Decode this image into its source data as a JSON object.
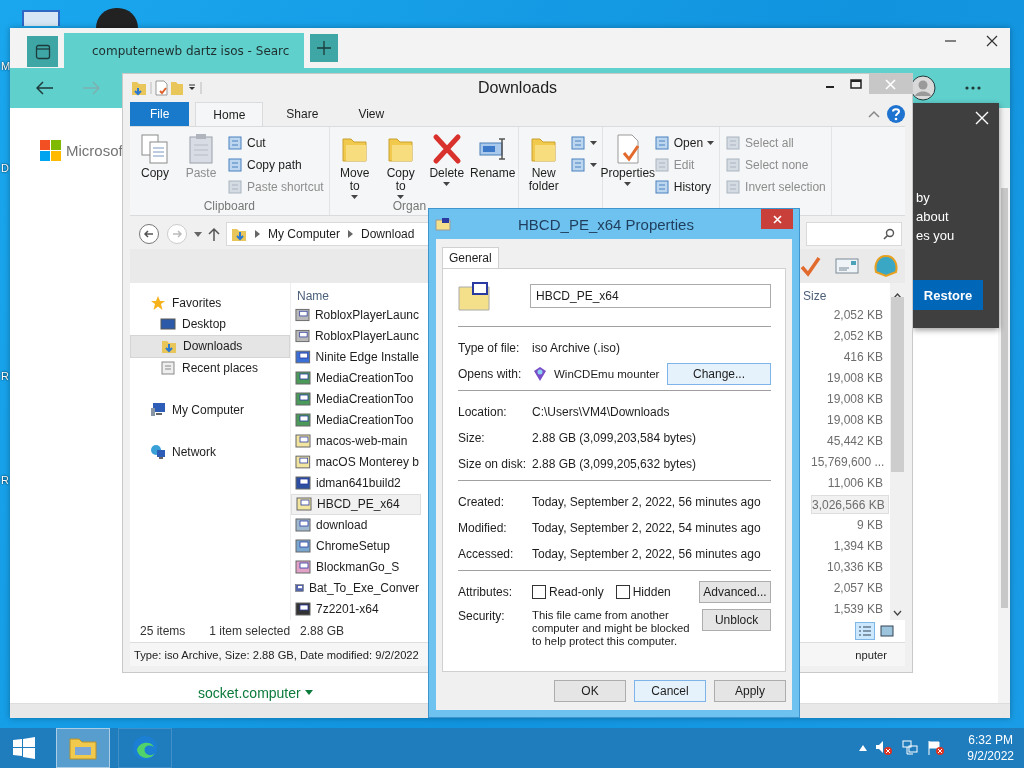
{
  "desktop": {
    "edge_labels": [
      "M",
      "D",
      "R",
      "R"
    ]
  },
  "browser": {
    "tab": {
      "title": "computernewb dartz isos - Searc"
    },
    "logo_text": "Microsof",
    "link": "socket.computer",
    "notice": {
      "lines": [
        "by",
        "about",
        "es you"
      ],
      "button": "Restore"
    }
  },
  "explorer": {
    "title": "Downloads",
    "ribbon_tabs": [
      {
        "label": "File",
        "kind": "menu",
        "selected": false
      },
      {
        "label": "Home",
        "kind": "tab",
        "selected": true
      },
      {
        "label": "Share",
        "kind": "tab",
        "selected": false
      },
      {
        "label": "View",
        "kind": "tab",
        "selected": false
      }
    ],
    "groups": [
      {
        "label": "Clipboard",
        "large": [
          {
            "label": "Copy",
            "dropdown": false,
            "disabled": false
          },
          {
            "label": "Paste",
            "dropdown": false,
            "disabled": true
          }
        ],
        "small": [
          {
            "label": "Cut",
            "dropdown": false,
            "disabled": false
          },
          {
            "label": "Copy path",
            "dropdown": false,
            "disabled": false
          },
          {
            "label": "Paste shortcut",
            "dropdown": false,
            "disabled": true
          }
        ]
      },
      {
        "label": "Organ",
        "large": [
          {
            "label": "Move to",
            "dropdown": true,
            "disabled": false
          },
          {
            "label": "Copy to",
            "dropdown": true,
            "disabled": false
          },
          {
            "label": "Delete",
            "dropdown": true,
            "disabled": false
          },
          {
            "label": "Rename",
            "dropdown": false,
            "disabled": false
          }
        ]
      },
      {
        "large": [
          {
            "label": "New folder",
            "dropdown": false,
            "disabled": false
          }
        ],
        "small": [
          {
            "dropdown": true,
            "disabled": false
          },
          {
            "dropdown": true,
            "disabled": false
          }
        ]
      },
      {
        "large": [
          {
            "label": "Properties",
            "dropdown": true,
            "disabled": false
          }
        ],
        "small": [
          {
            "label": "Open",
            "dropdown": true,
            "disabled": false
          },
          {
            "label": "Edit",
            "dropdown": false,
            "disabled": true
          },
          {
            "label": "History",
            "dropdown": false,
            "disabled": false
          }
        ]
      },
      {
        "small": [
          {
            "label": "Select all",
            "dropdown": false,
            "disabled": true
          },
          {
            "label": "Select none",
            "dropdown": false,
            "disabled": true
          },
          {
            "label": "Invert selection",
            "dropdown": false,
            "disabled": true
          }
        ]
      }
    ],
    "crumbs": [
      "My Computer",
      "Download"
    ],
    "nav": [
      {
        "label": "Favorites",
        "selected": false,
        "children": [
          {
            "label": "Desktop",
            "selected": false
          },
          {
            "label": "Downloads",
            "selected": true
          },
          {
            "label": "Recent places",
            "selected": false
          }
        ]
      },
      {
        "label": "My Computer",
        "selected": false
      },
      {
        "label": "Network",
        "selected": false
      }
    ],
    "columns": {
      "name": "Name",
      "size": "Size"
    },
    "files": [
      {
        "name": "RobloxPlayerLaunc",
        "size": "2,052 KB",
        "selected": false
      },
      {
        "name": "RobloxPlayerLaunc",
        "size": "2,052 KB",
        "selected": false
      },
      {
        "name": "Ninite Edge Installe",
        "size": "416 KB",
        "selected": false
      },
      {
        "name": "MediaCreationToo",
        "size": "19,008 KB",
        "selected": false
      },
      {
        "name": "MediaCreationToo",
        "size": "19,008 KB",
        "selected": false
      },
      {
        "name": "MediaCreationToo",
        "size": "19,008 KB",
        "selected": false
      },
      {
        "name": "macos-web-main",
        "size": "45,442 KB",
        "selected": false
      },
      {
        "name": "macOS Monterey b",
        "size": "15,769,600 ...",
        "selected": false
      },
      {
        "name": "idman641build2",
        "size": "11,006 KB",
        "selected": false
      },
      {
        "name": "HBCD_PE_x64",
        "size": "3,026,566 KB",
        "selected": true
      },
      {
        "name": "download",
        "size": "9 KB",
        "selected": false
      },
      {
        "name": "ChromeSetup",
        "size": "1,394 KB",
        "selected": false
      },
      {
        "name": "BlockmanGo_S",
        "size": "10,336 KB",
        "selected": false
      },
      {
        "name": "Bat_To_Exe_Conver",
        "size": "2,057 KB",
        "selected": false
      },
      {
        "name": "7z2201-x64",
        "size": "1,539 KB",
        "selected": false
      }
    ],
    "status": {
      "count": "25 items",
      "selection": "1 item selected",
      "selection_size": "2.88 GB"
    },
    "views": [
      {
        "selected": true
      },
      {
        "selected": false
      }
    ],
    "details": {
      "text": "Type: iso Archive, Size: 2.88 GB, Date modified: 9/2/2022",
      "right": "nputer"
    }
  },
  "dialog": {
    "title": "HBCD_PE_x64 Properties",
    "tabs": [
      {
        "label": "General",
        "selected": true
      }
    ],
    "name": "HBCD_PE_x64",
    "sections": [
      [
        {
          "label": "Type of file:",
          "value": "iso Archive (.iso)"
        },
        {
          "label": "Opens with:",
          "value": "WinCDEmu mounter",
          "button": "Change..."
        }
      ],
      [
        {
          "label": "Location:",
          "value": "C:\\Users\\VM4\\Downloads"
        },
        {
          "label": "Size:",
          "value": "2.88 GB (3,099,203,584 bytes)"
        },
        {
          "label": "Size on disk:",
          "value": "2.88 GB (3,099,205,632 bytes)"
        }
      ],
      [
        {
          "label": "Created:",
          "value": "Today, September 2, 2022, 56 minutes ago"
        },
        {
          "label": "Modified:",
          "value": "Today, September 2, 2022, 54 minutes ago"
        },
        {
          "label": "Accessed:",
          "value": "Today, September 2, 2022, 56 minutes ago"
        }
      ]
    ],
    "attributes": {
      "label": "Attributes:",
      "checks": [
        {
          "label": "Read-only",
          "checked": false
        },
        {
          "label": "Hidden",
          "checked": false
        }
      ],
      "button": "Advanced..."
    },
    "security": {
      "label": "Security:",
      "text": "This file came from another computer and might be blocked to help protect this computer.",
      "button": "Unblock"
    },
    "buttons": [
      {
        "label": "OK",
        "highlighted": false
      },
      {
        "label": "Cancel",
        "highlighted": true
      },
      {
        "label": "Apply",
        "highlighted": false
      }
    ]
  },
  "taskbar": {
    "time": "6:32 PM",
    "date": "9/2/2022"
  }
}
